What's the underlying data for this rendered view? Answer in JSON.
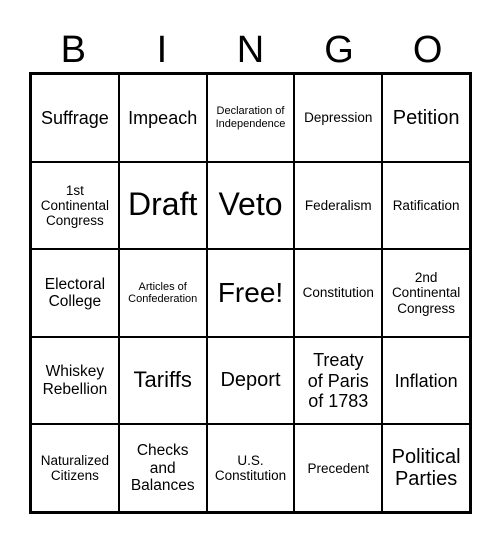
{
  "header": {
    "letters": [
      "B",
      "I",
      "N",
      "G",
      "O"
    ]
  },
  "cells": [
    [
      "Suffrage",
      "Impeach",
      "Declaration of Independence",
      "Depression",
      "Petition"
    ],
    [
      "1st Continental Congress",
      "Draft",
      "Veto",
      "Federalism",
      "Ratification"
    ],
    [
      "Electoral College",
      "Articles of Confederation",
      "Free!",
      "Constitution",
      "2nd Continental Congress"
    ],
    [
      "Whiskey Rebellion",
      "Tariffs",
      "Deport",
      "Treaty of Paris of 1783",
      "Inflation"
    ],
    [
      "Naturalized Citizens",
      "Checks and Balances",
      "U.S. Constitution",
      "Precedent",
      "Political Parties"
    ]
  ],
  "cell_lines": [
    [
      [
        "Suffrage"
      ],
      [
        "Impeach"
      ],
      [
        "Declaration of",
        "Independence"
      ],
      [
        "Depression"
      ],
      [
        "Petition"
      ]
    ],
    [
      [
        "1st",
        "Continental",
        "Congress"
      ],
      [
        "Draft"
      ],
      [
        "Veto"
      ],
      [
        "Federalism"
      ],
      [
        "Ratification"
      ]
    ],
    [
      [
        "Electoral",
        "College"
      ],
      [
        "Articles of",
        "Confederation"
      ],
      [
        "Free!"
      ],
      [
        "Constitution"
      ],
      [
        "2nd",
        "Continental",
        "Congress"
      ]
    ],
    [
      [
        "Whiskey",
        "Rebellion"
      ],
      [
        "Tariffs"
      ],
      [
        "Deport"
      ],
      [
        "Treaty",
        "of Paris",
        "of 1783"
      ],
      [
        "Inflation"
      ]
    ],
    [
      [
        "Naturalized",
        "Citizens"
      ],
      [
        "Checks",
        "and",
        "Balances"
      ],
      [
        "U.S.",
        "Constitution"
      ],
      [
        "Precedent"
      ],
      [
        "Political",
        "Parties"
      ]
    ]
  ]
}
